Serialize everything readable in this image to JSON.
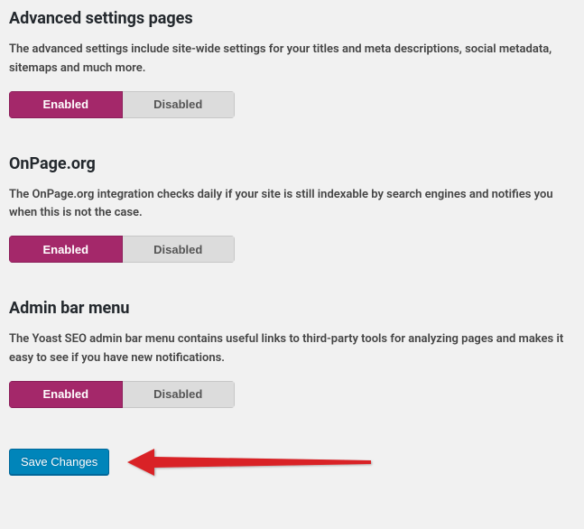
{
  "sections": [
    {
      "heading": "Advanced settings pages",
      "description": "The advanced settings include site-wide settings for your titles and meta descriptions, social metadata, sitemaps and much more."
    },
    {
      "heading": "OnPage.org",
      "description": "The OnPage.org integration checks daily if your site is still indexable by search engines and notifies you when this is not the case."
    },
    {
      "heading": "Admin bar menu",
      "description": "The Yoast SEO admin bar menu contains useful links to third-party tools for analyzing pages and makes it easy to see if you have new notifications."
    }
  ],
  "toggle": {
    "enabled": "Enabled",
    "disabled": "Disabled"
  },
  "save_button": "Save Changes"
}
